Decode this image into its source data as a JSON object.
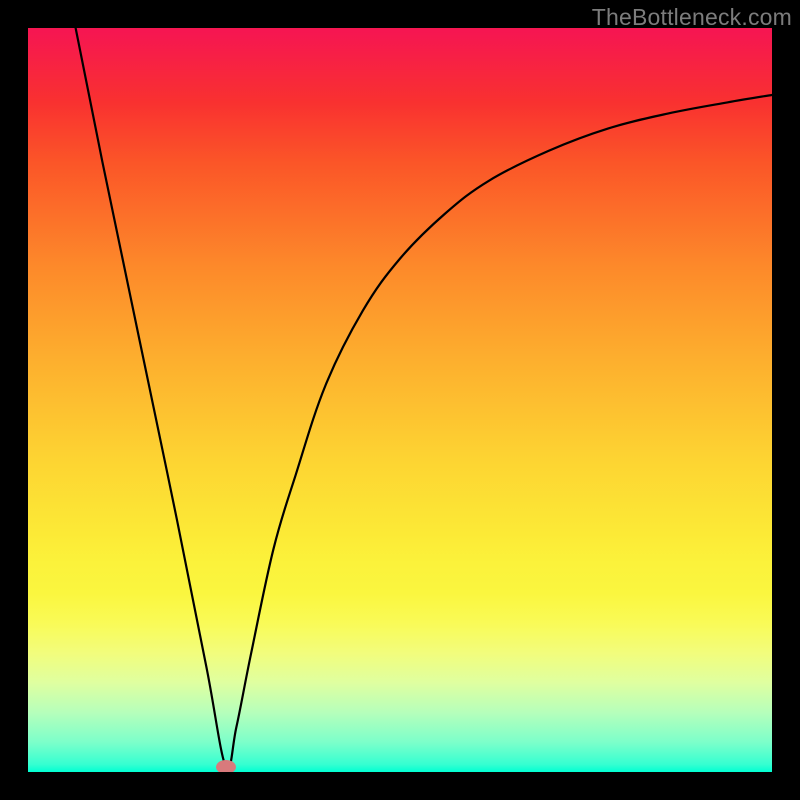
{
  "watermark": "TheBottleneck.com",
  "marker": {
    "x_pct": 26.6,
    "y_pct": 99.3
  },
  "chart_data": {
    "type": "line",
    "title": "",
    "xlabel": "",
    "ylabel": "",
    "xlim": [
      0,
      100
    ],
    "ylim": [
      0,
      100
    ],
    "series": [
      {
        "name": "curve",
        "x": [
          6.4,
          10,
          15,
          20,
          24,
          26.6,
          28,
          30,
          33,
          36,
          40,
          45,
          50,
          56,
          62,
          70,
          78,
          86,
          94,
          100
        ],
        "y": [
          100,
          82,
          58,
          34,
          14,
          0.7,
          6,
          16,
          30,
          40,
          52,
          62,
          69,
          75,
          79.5,
          83.5,
          86.5,
          88.5,
          90,
          91
        ]
      }
    ],
    "annotations": [
      {
        "type": "marker",
        "x": 26.6,
        "y": 0.7,
        "color": "#d87a7c"
      }
    ],
    "background_gradient": {
      "stops": [
        {
          "pos": 0.0,
          "color": "#f61651"
        },
        {
          "pos": 0.1,
          "color": "#f93130"
        },
        {
          "pos": 0.18,
          "color": "#fb5528"
        },
        {
          "pos": 0.32,
          "color": "#fd892a"
        },
        {
          "pos": 0.45,
          "color": "#fdb02e"
        },
        {
          "pos": 0.58,
          "color": "#fdd432"
        },
        {
          "pos": 0.68,
          "color": "#fcea36"
        },
        {
          "pos": 0.8,
          "color": "#f9fb57"
        },
        {
          "pos": 0.88,
          "color": "#dfffa0"
        },
        {
          "pos": 0.96,
          "color": "#7cffca"
        },
        {
          "pos": 1.0,
          "color": "#00ffd2"
        }
      ]
    }
  }
}
